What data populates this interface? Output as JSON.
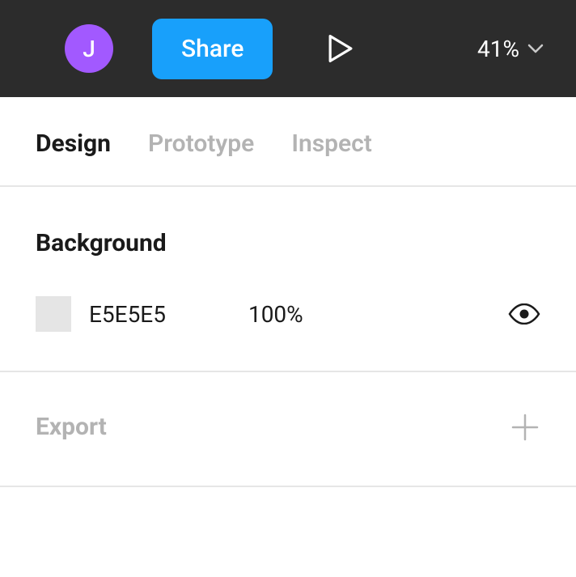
{
  "toolbar": {
    "avatar_initial": "J",
    "share_label": "Share",
    "zoom_value": "41%"
  },
  "tabs": {
    "design": "Design",
    "prototype": "Prototype",
    "inspect": "Inspect"
  },
  "background": {
    "title": "Background",
    "hex": "E5E5E5",
    "opacity": "100%",
    "swatch_color": "#E5E5E5"
  },
  "export": {
    "title": "Export"
  }
}
